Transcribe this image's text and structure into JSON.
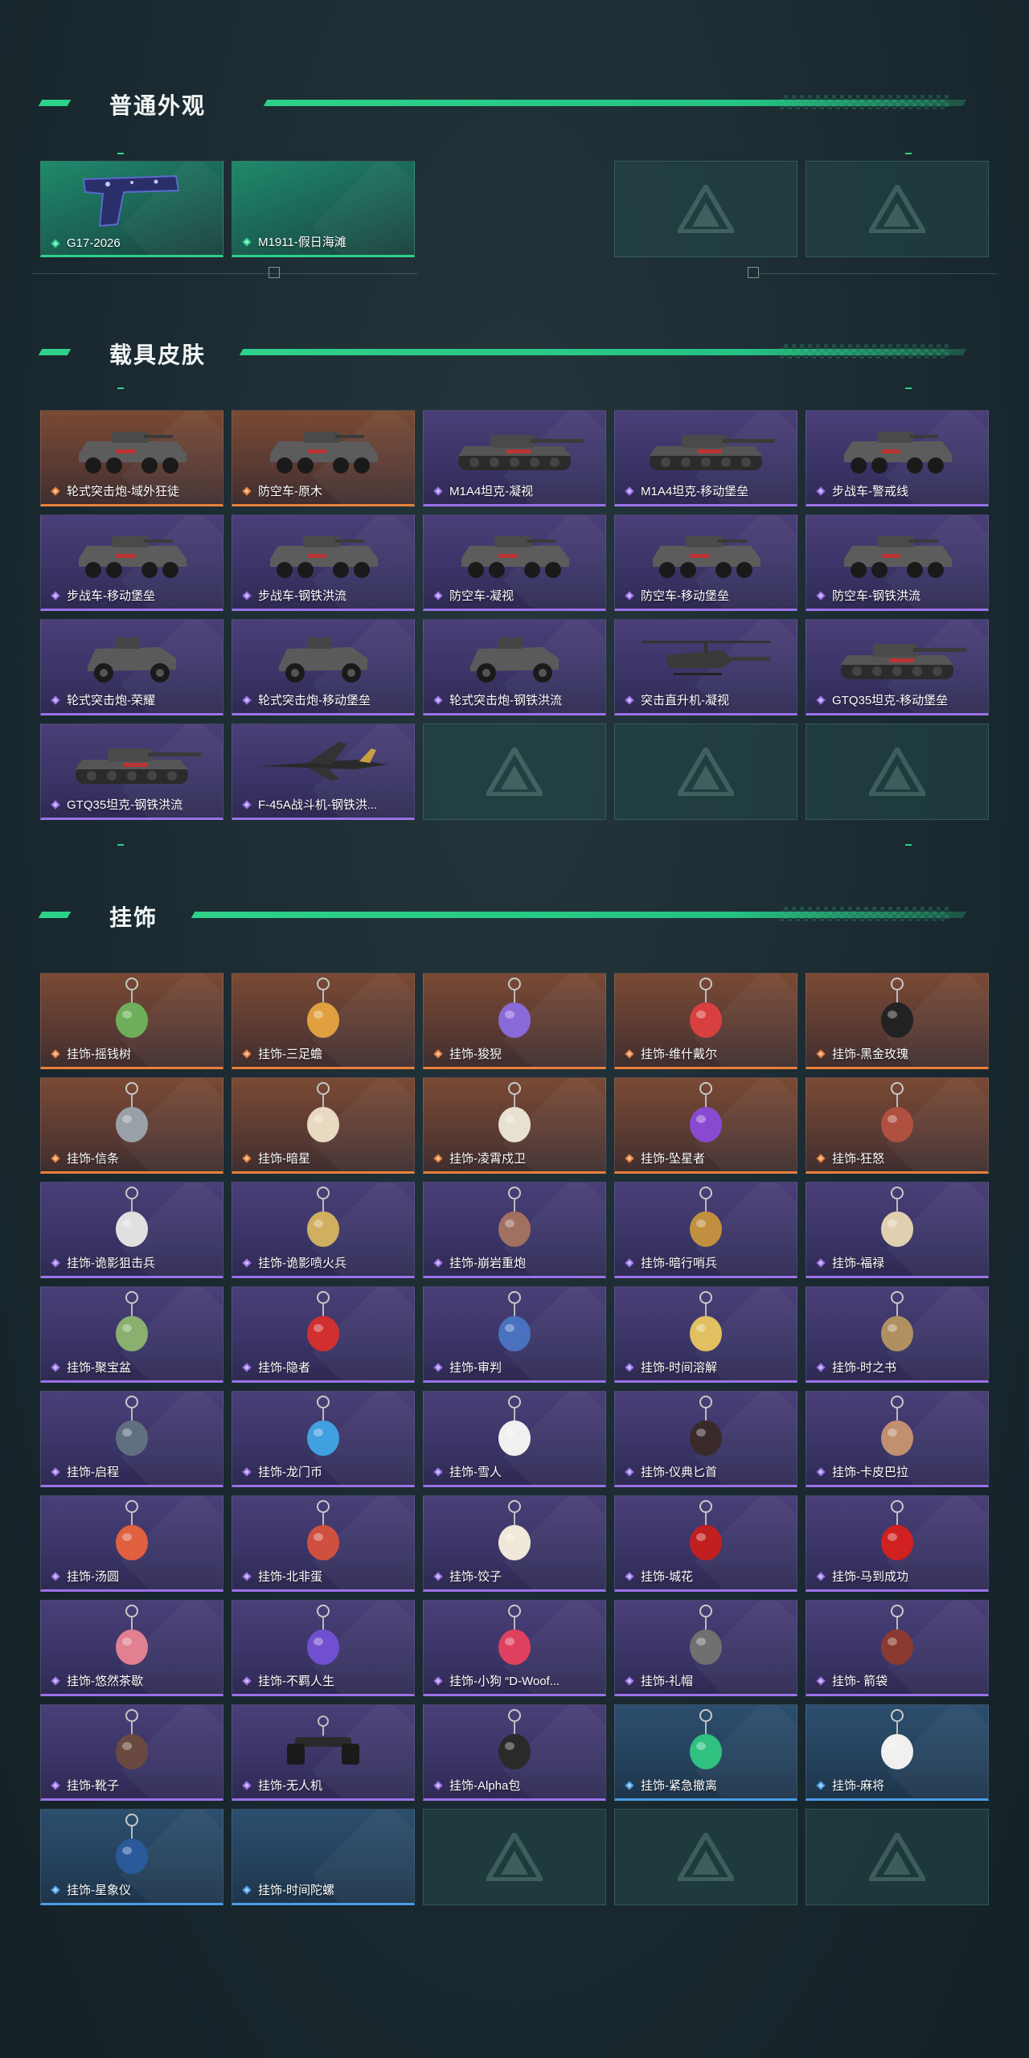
{
  "sections": [
    {
      "title": "普通外观",
      "items": [
        {
          "label": "G17-2026",
          "rarity": "green",
          "art": "pistol-blue"
        },
        {
          "label": "M1911-假日海滩",
          "rarity": "green",
          "art": "none"
        },
        {
          "empty": true
        },
        {
          "empty": true
        }
      ]
    },
    {
      "title": "载具皮肤",
      "items": [
        {
          "label": "轮式突击炮-域外狂徒",
          "rarity": "orange",
          "art": "vehicle"
        },
        {
          "label": "防空车-原木",
          "rarity": "orange",
          "art": "vehicle"
        },
        {
          "label": "M1A4坦克-凝视",
          "rarity": "purple",
          "art": "tank"
        },
        {
          "label": "M1A4坦克-移动堡垒",
          "rarity": "purple",
          "art": "tank"
        },
        {
          "label": "步战车-警戒线",
          "rarity": "purple",
          "art": "vehicle"
        },
        {
          "label": "步战车-移动堡垒",
          "rarity": "purple",
          "art": "vehicle"
        },
        {
          "label": "步战车-钢铁洪流",
          "rarity": "purple",
          "art": "vehicle"
        },
        {
          "label": "防空车-凝视",
          "rarity": "purple",
          "art": "vehicle"
        },
        {
          "label": "防空车-移动堡垒",
          "rarity": "purple",
          "art": "vehicle"
        },
        {
          "label": "防空车-钢铁洪流",
          "rarity": "purple",
          "art": "vehicle"
        },
        {
          "label": "轮式突击炮-荣耀",
          "rarity": "purple",
          "art": "buggy"
        },
        {
          "label": "轮式突击炮-移动堡垒",
          "rarity": "purple",
          "art": "buggy"
        },
        {
          "label": "轮式突击炮-钢铁洪流",
          "rarity": "purple",
          "art": "buggy"
        },
        {
          "label": "突击直升机-凝视",
          "rarity": "purple",
          "art": "heli"
        },
        {
          "label": "GTQ35坦克-移动堡垒",
          "rarity": "purple",
          "art": "tank"
        },
        {
          "label": "GTQ35坦克-钢铁洪流",
          "rarity": "purple",
          "art": "tank"
        },
        {
          "label": "F-45A战斗机-钢铁洪...",
          "rarity": "purple",
          "art": "jet"
        },
        {
          "empty": true
        },
        {
          "empty": true
        },
        {
          "empty": true
        }
      ]
    },
    {
      "title": "挂饰",
      "items": [
        {
          "label": "挂饰-摇钱树",
          "rarity": "orange",
          "art": "charm",
          "color": "#6fae5a"
        },
        {
          "label": "挂饰-三足蟾",
          "rarity": "orange",
          "art": "charm",
          "color": "#e0a040"
        },
        {
          "label": "挂饰-狻猊",
          "rarity": "orange",
          "art": "charm",
          "color": "#8a6ad8"
        },
        {
          "label": "挂饰-维什戴尔",
          "rarity": "orange",
          "art": "charm",
          "color": "#d84040"
        },
        {
          "label": "挂饰-黑金玫瑰",
          "rarity": "orange",
          "art": "charm",
          "color": "#222222"
        },
        {
          "label": "挂饰-信条",
          "rarity": "orange",
          "art": "charm",
          "color": "#9aa0a8"
        },
        {
          "label": "挂饰-暗星",
          "rarity": "orange",
          "art": "charm",
          "color": "#e8d9c0"
        },
        {
          "label": "挂饰-凌霄戍卫",
          "rarity": "orange",
          "art": "charm",
          "color": "#e8e0d0"
        },
        {
          "label": "挂饰-坠星者",
          "rarity": "orange",
          "art": "charm",
          "color": "#8a4ad0"
        },
        {
          "label": "挂饰-狂怒",
          "rarity": "orange",
          "art": "charm",
          "color": "#b05040"
        },
        {
          "label": "挂饰-诡影狙击兵",
          "rarity": "purple",
          "art": "charm",
          "color": "#e0e0e0"
        },
        {
          "label": "挂饰-诡影喷火兵",
          "rarity": "purple",
          "art": "charm",
          "color": "#d0b060"
        },
        {
          "label": "挂饰-崩岩重炮",
          "rarity": "purple",
          "art": "charm",
          "color": "#a07060"
        },
        {
          "label": "挂饰-暗行哨兵",
          "rarity": "purple",
          "art": "charm",
          "color": "#c09040"
        },
        {
          "label": "挂饰-福禄",
          "rarity": "purple",
          "art": "charm",
          "color": "#e0d0b0"
        },
        {
          "label": "挂饰-聚宝盆",
          "rarity": "purple",
          "art": "charm",
          "color": "#8ab070"
        },
        {
          "label": "挂饰-隐者",
          "rarity": "purple",
          "art": "charm",
          "color": "#d03030"
        },
        {
          "label": "挂饰-审判",
          "rarity": "purple",
          "art": "charm",
          "color": "#4a70c0"
        },
        {
          "label": "挂饰-时间溶解",
          "rarity": "purple",
          "art": "charm",
          "color": "#e0c060"
        },
        {
          "label": "挂饰-时之书",
          "rarity": "purple",
          "art": "charm",
          "color": "#b09060"
        },
        {
          "label": "挂饰-启程",
          "rarity": "purple",
          "art": "charm",
          "color": "#607080"
        },
        {
          "label": "挂饰-龙门币",
          "rarity": "purple",
          "art": "charm",
          "color": "#40a0e0"
        },
        {
          "label": "挂饰-雪人",
          "rarity": "purple",
          "art": "charm",
          "color": "#f0f0f0"
        },
        {
          "label": "挂饰-仪典匕首",
          "rarity": "purple",
          "art": "charm",
          "color": "#3a2a2a"
        },
        {
          "label": "挂饰-卡皮巴拉",
          "rarity": "purple",
          "art": "charm",
          "color": "#c09070"
        },
        {
          "label": "挂饰-汤圆",
          "rarity": "purple",
          "art": "charm",
          "color": "#e06040"
        },
        {
          "label": "挂饰-北非蛋",
          "rarity": "purple",
          "art": "charm",
          "color": "#d05040"
        },
        {
          "label": "挂饰-饺子",
          "rarity": "purple",
          "art": "charm",
          "color": "#f0e8d8"
        },
        {
          "label": "挂饰-城花",
          "rarity": "purple",
          "art": "charm",
          "color": "#c02020"
        },
        {
          "label": "挂饰-马到成功",
          "rarity": "purple",
          "art": "charm",
          "color": "#d02020"
        },
        {
          "label": "挂饰-悠然茶歇",
          "rarity": "purple",
          "art": "charm",
          "color": "#e08090"
        },
        {
          "label": "挂饰-不羁人生",
          "rarity": "purple",
          "art": "charm",
          "color": "#7050d0"
        },
        {
          "label": "挂饰-小狗 “D-Woof...",
          "rarity": "purple",
          "art": "charm",
          "color": "#e04060"
        },
        {
          "label": "挂饰-礼帽",
          "rarity": "purple",
          "art": "charm",
          "color": "#707070"
        },
        {
          "label": "挂饰- 箭袋",
          "rarity": "purple",
          "art": "charm",
          "color": "#8a3a30"
        },
        {
          "label": "挂饰-靴子",
          "rarity": "purple",
          "art": "charm",
          "color": "#6a4a40"
        },
        {
          "label": "挂饰-无人机",
          "rarity": "purple",
          "art": "drone",
          "color": "#333333"
        },
        {
          "label": "挂饰-Alpha包",
          "rarity": "purple",
          "art": "charm",
          "color": "#2a2a2a"
        },
        {
          "label": "挂饰-紧急撤离",
          "rarity": "blue",
          "art": "charm",
          "color": "#30c080"
        },
        {
          "label": "挂饰-麻将",
          "rarity": "blue",
          "art": "charm",
          "color": "#f0f0f0"
        },
        {
          "label": "挂饰-星象仪",
          "rarity": "blue",
          "art": "charm",
          "color": "#2a5a9a"
        },
        {
          "label": "挂饰-时间陀螺",
          "rarity": "blue",
          "art": "none",
          "color": "#333333"
        },
        {
          "empty": true
        },
        {
          "empty": true
        },
        {
          "empty": true
        }
      ]
    }
  ],
  "colors": {
    "accent_green": "#2ed18a",
    "rarity_green": "#2ed18a",
    "rarity_orange": "#e8803a",
    "rarity_purple": "#9a72e8",
    "rarity_blue": "#4a9ee8"
  }
}
